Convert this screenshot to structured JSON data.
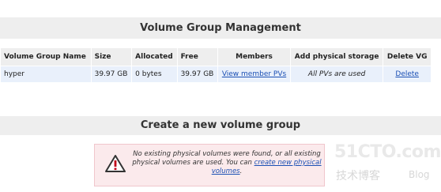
{
  "vg_section": {
    "title": "Volume Group Management"
  },
  "vg_table": {
    "headers": [
      "Volume Group Name",
      "Size",
      "Allocated",
      "Free",
      "Members",
      "Add physical storage",
      "Delete VG"
    ],
    "rows": [
      {
        "name": "hyper",
        "size": "39.97 GB",
        "allocated": "0 bytes",
        "free": "39.97 GB",
        "members": "View member PVs",
        "add_storage": "All PVs are used",
        "delete": "Delete"
      }
    ]
  },
  "create_section": {
    "title": "Create a new volume group"
  },
  "notice": {
    "text": "No existing physical volumes were found, or all existing physical volumes are used. You can",
    "link": "create new physical volumes",
    "suffix": "."
  },
  "watermark": {
    "top": "51CTO.com",
    "bottom": "技术博客",
    "blog": "Blog"
  },
  "colors": {
    "header_bg": "#eeeeee",
    "row_bg": "#e9f0fb",
    "link": "#1a4fb4",
    "notice_bg": "#fbeaec"
  }
}
